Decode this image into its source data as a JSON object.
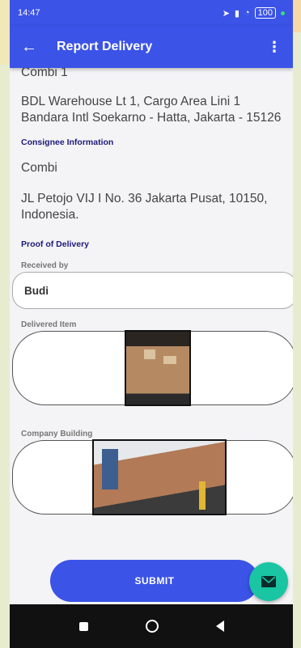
{
  "status_bar": {
    "time": "14:47",
    "battery": "100"
  },
  "app_bar": {
    "title": "Report Delivery"
  },
  "shipper": {
    "name_partial": "Combi 1",
    "address": "BDL Warehouse Lt 1, Cargo Area Lini 1 Bandara Intl Soekarno - Hatta, Jakarta - 15126"
  },
  "consignee": {
    "heading": "Consignee Information",
    "name": "Combi",
    "address": "JL Petojo VIJ I No. 36 Jakarta Pusat, 10150, Indonesia."
  },
  "proof": {
    "heading": "Proof of Delivery",
    "received_by_label": "Received by",
    "received_by_value": "Budi",
    "delivered_item_label": "Delivered Item",
    "company_building_label": "Company Building"
  },
  "actions": {
    "submit_label": "SUBMIT"
  }
}
